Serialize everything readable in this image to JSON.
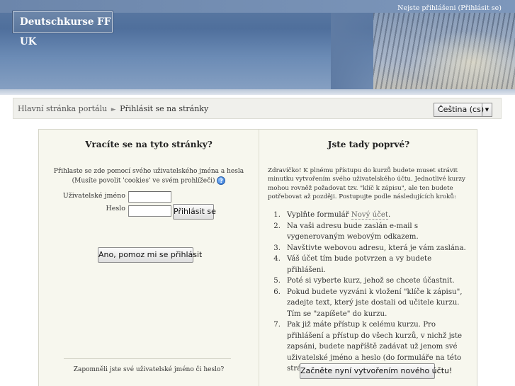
{
  "header": {
    "site_title": "Deutschkurse FF UK",
    "login_status": "Nejste přihlášeni",
    "login_link": "Přihlásit se"
  },
  "navbar": {
    "breadcrumb_home": "Hlavní stránka portálu",
    "breadcrumb_separator": "►",
    "breadcrumb_current": "Přihlásit se na stránky",
    "language_selected": "Čeština (cs)"
  },
  "left": {
    "heading": "Vracíte se na tyto stránky?",
    "description_line1": "Přihlaste se zde pomocí svého uživatelského jména a hesla",
    "description_line2": "(Musíte povolit 'cookies' ve svém prohlížeči)",
    "help_icon_glyph": "?",
    "username_label": "Uživatelské jméno",
    "username_value": "",
    "password_label": "Heslo",
    "password_value": "",
    "login_button": "Přihlásit se",
    "forgot_text": "Zapomněli jste své uživatelské jméno či heslo?",
    "forgot_button": "Ano, pomoz mi se přihlásit"
  },
  "right": {
    "heading": "Jste tady poprvé?",
    "intro": "Zdravíčko! K plnému přístupu do kurzů budete muset strávit minutku vytvořením svého uživatelského účtu. Jednotlivé kurzy mohou rovněž požadovat tzv. \"klíč k zápisu\", ale ten budete potřebovat až později. Postupujte podle následujících kroků:",
    "step1_prefix": "Vyplňte formulář ",
    "step1_link": "Nový účet",
    "step1_suffix": ".",
    "steps": [
      "Na vaši adresu bude zaslán e-mail s vygenerovaným webovým odkazem.",
      "Navštivte webovou adresu, která je vám zaslána.",
      "Váš účet tím bude potvrzen a vy budete přihlášeni.",
      "Poté si vyberte kurz, jehož se chcete účastnit.",
      "Pokud budete vyzváni k vložení \"klíče k zápisu\", zadejte text, který jste dostali od učitele kurzu. Tím se \"zapíšete\" do kurzu.",
      "Pak již máte přístup k celému kurzu. Pro přihlášení a přístup do všech kurzů, v nichž jste zapsáni, budete napříště zadávat už jenom své uživatelské jméno a heslo (do formuláře na této stránce)."
    ],
    "numbers": [
      "1.",
      "2.",
      "3.",
      "4.",
      "5.",
      "6.",
      "7."
    ],
    "signup_button": "Začněte nyní vytvořením nového účtu!"
  }
}
